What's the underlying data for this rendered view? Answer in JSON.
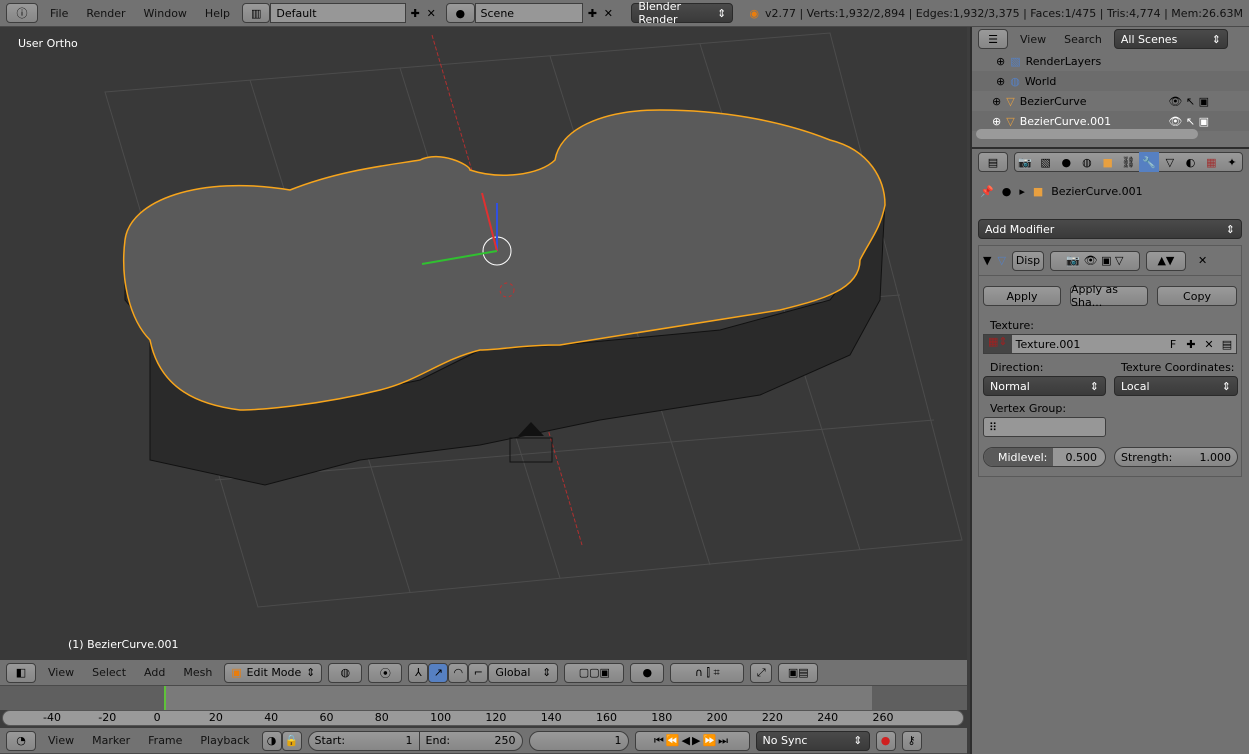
{
  "topbar": {
    "menus": [
      "File",
      "Render",
      "Window",
      "Help"
    ],
    "layout": "Default",
    "scene": "Scene",
    "engine": "Blender Render",
    "stats": "v2.77 | Verts:1,932/2,894 | Edges:1,932/3,375 | Faces:1/475 | Tris:4,774 | Mem:26.63M"
  },
  "viewport": {
    "view_label": "User Ortho",
    "object_label": "(1) BezierCurve.001"
  },
  "view3d_header": {
    "menus": [
      "View",
      "Select",
      "Add",
      "Mesh"
    ],
    "mode": "Edit Mode",
    "orientation": "Global"
  },
  "timeline": {
    "ticks": [
      "-40",
      "-20",
      "0",
      "20",
      "40",
      "60",
      "80",
      "100",
      "120",
      "140",
      "160",
      "180",
      "200",
      "220",
      "240",
      "260"
    ],
    "menus": [
      "View",
      "Marker",
      "Frame",
      "Playback"
    ],
    "start_label": "Start:",
    "start": "1",
    "end_label": "End:",
    "end": "250",
    "current": "1",
    "sync": "No Sync",
    "current_frame_color": "#5fc23a"
  },
  "outliner": {
    "menus": [
      "View",
      "Search"
    ],
    "filter": "All Scenes",
    "items": [
      {
        "name": "RenderLayers"
      },
      {
        "name": "World"
      },
      {
        "name": "BezierCurve"
      },
      {
        "name": "BezierCurve.001",
        "selected": true
      }
    ]
  },
  "properties": {
    "object_name": "BezierCurve.001",
    "add_modifier": "Add Modifier",
    "modifier_name": "Disp",
    "apply": "Apply",
    "apply_shape": "Apply as Sha...",
    "copy": "Copy",
    "texture_label": "Texture:",
    "texture": "Texture.001",
    "texture_f": "F",
    "direction_label": "Direction:",
    "direction": "Normal",
    "coords_label": "Texture Coordinates:",
    "coords": "Local",
    "vgroup_label": "Vertex Group:",
    "midlevel_label": "Midlevel:",
    "midlevel": "0.500",
    "strength_label": "Strength:",
    "strength": "1.000"
  },
  "colors": {
    "accent": "#5680c2",
    "selection": "#f7a51c"
  }
}
